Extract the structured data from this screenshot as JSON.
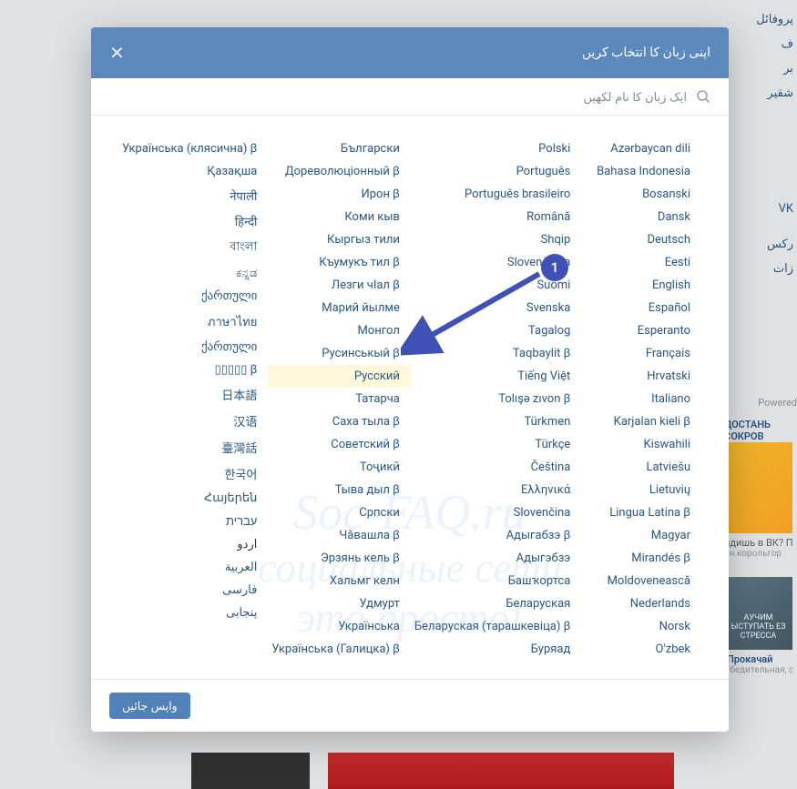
{
  "modal": {
    "title": "اپنی زبان کا انتخاب کریں",
    "search_placeholder": "ایک زبان کا نام لکھیں",
    "back_button": "واپس جائیں"
  },
  "annotation": {
    "number": "1"
  },
  "watermark": {
    "line1": "Soc-FAQ.ru",
    "line2": "социальные сети",
    "line3": "это просто!"
  },
  "sidebar": {
    "items": [
      "پروفائل",
      "ف",
      "بر",
      "شقیر",
      "",
      "VK",
      "",
      "رکس",
      "زات"
    ]
  },
  "powered_by": "Powered",
  "ads": {
    "t1": "ДОСТАНЬ СОКРОВ",
    "t2": "идишь в ВК? П",
    "t3": "нн.корольгор",
    "t4": "!Прокачай",
    "t5": "Убедительная, с",
    "t6": "АУЧИМ ЫСТУПАТЬ ЕЗ СТРЕССА"
  },
  "columns": [
    [
      "Azərbaycan dili",
      "Bahasa Indonesia",
      "Bosanski",
      "Dansk",
      "Deutsch",
      "Eesti",
      "English",
      "Español",
      "Esperanto",
      "Français",
      "Hrvatski",
      "Italiano",
      "Karjalan kieli β",
      "Kiswahili",
      "Latviešu",
      "Lietuvių",
      "Lingua Latina β",
      "Magyar",
      "Mirandés β",
      "Moldovenească",
      "Nederlands",
      "Norsk",
      "O'zbek"
    ],
    [
      "Polski",
      "Português",
      "Português brasileiro",
      "Română",
      "Shqip",
      "Slovenščina",
      "Suomi",
      "Svenska",
      "Tagalog",
      "Taqbaylit β",
      "Tiếng Việt",
      "Tolışə zıvon β",
      "Türkmen",
      "Türkçe",
      "Čeština",
      "Ελληνικά",
      "Slovenčina",
      "Адыгабзэ β",
      "Адыгэбзэ",
      "Башҡортса",
      "Беларуская",
      "Беларуская (тарашкевіца) β",
      "Буряад"
    ],
    [
      "Български",
      "Дореволюціонный β",
      "Ирон β",
      "Коми кыв",
      "Кыргыз тили",
      "Къумукъ тил β",
      "Лезги чӏал β",
      "Марий йылме",
      "Монгол",
      "Русинськый β",
      "Русский",
      "Татарча",
      "Саха тыла β",
      "Советский β",
      "Тоҷикӣ",
      "Тыва дыл β",
      "Српски",
      "Чӑвашла β",
      "Эрзянь кель β",
      "Хальмг келн",
      "Удмурт",
      "Українська",
      "Українська (Галицка) β"
    ],
    [
      "Українська (клясична) β",
      "Қазақша",
      "नेपाली",
      "हिन्दी",
      "বাংলা",
      "ಕನ್ನಡ",
      "ქართული",
      "ภาษาไทย",
      "ქართული",
      "日本語",
      "日本語",
      "汉语",
      "臺灣話",
      "한국어",
      "Հայերեն",
      "עברית",
      "اردو",
      "العربية",
      "فارسی",
      "پنجابی"
    ]
  ],
  "col4_actual": [
    "Українська (клясична) β",
    "Қазақша",
    "नेपाली",
    "हिन्दी",
    "বাংলা",
    "ಕನ್ನಡ",
    "ქართული",
    "ภาษาไทย",
    "ქართული",
    "▯▯▯▯▯ β",
    "日本語",
    "汉语",
    "臺灣話",
    "한국어",
    "Հայերեն",
    "עברית",
    "اردو",
    "العربية",
    "فارسی",
    "پنجابی"
  ],
  "highlighted_index": {
    "col": 2,
    "row": 10
  },
  "current_lang_index": {
    "col": 3,
    "row": 16
  }
}
